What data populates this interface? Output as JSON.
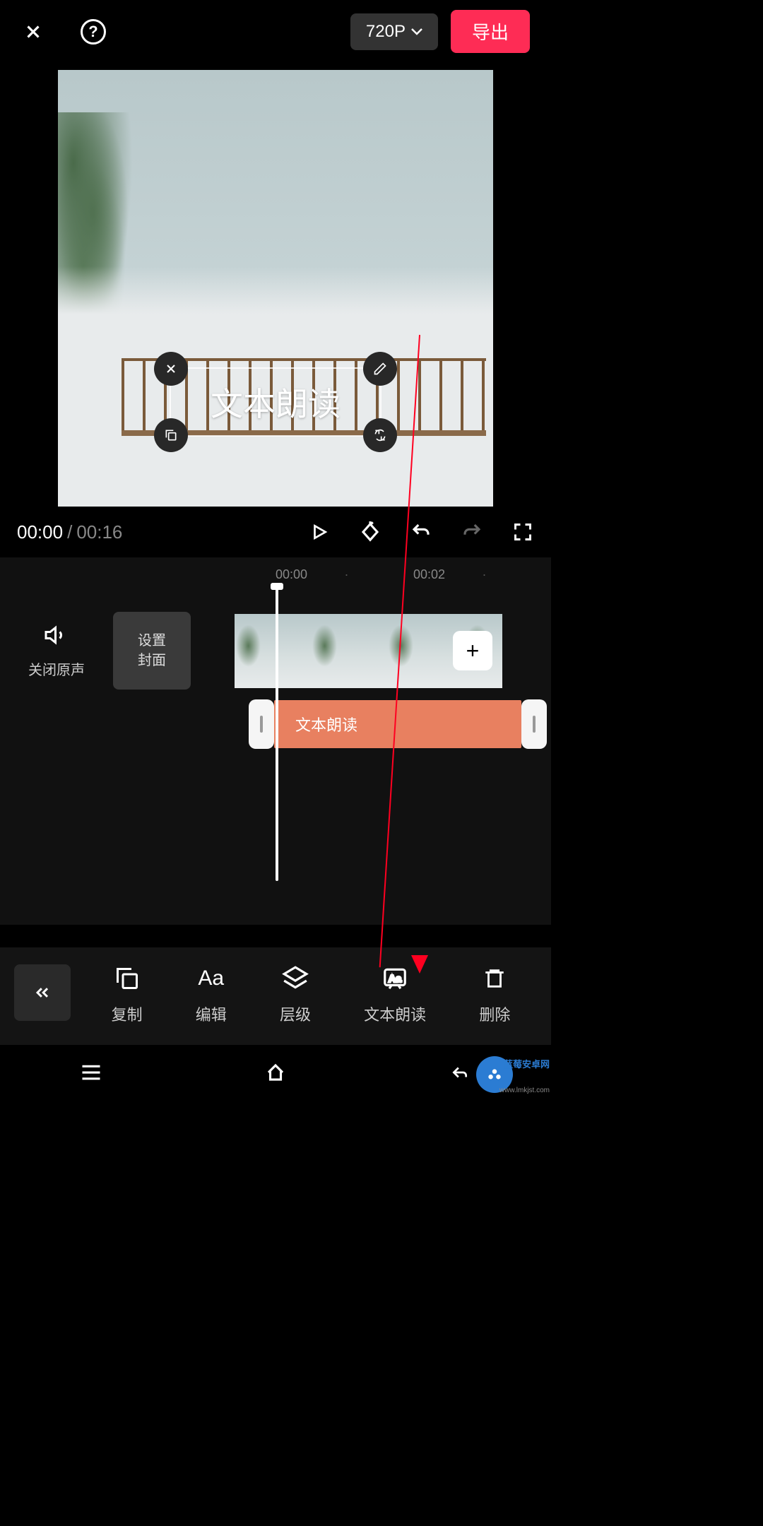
{
  "header": {
    "resolution": "720P",
    "export": "导出"
  },
  "preview": {
    "text_overlay": "文本朗读"
  },
  "playback": {
    "current": "00:00",
    "total": "00:16"
  },
  "timeline": {
    "marks": [
      "00:00",
      "·",
      "00:02",
      "·"
    ],
    "mute_label": "关闭原声",
    "cover_line1": "设置",
    "cover_line2": "封面",
    "text_clip": "文本朗读"
  },
  "toolbar": {
    "items": [
      {
        "icon": "copy",
        "label": "复制"
      },
      {
        "icon": "edit",
        "label": "编辑"
      },
      {
        "icon": "layers",
        "label": "层级"
      },
      {
        "icon": "tts",
        "label": "文本朗读"
      },
      {
        "icon": "delete",
        "label": "删除"
      }
    ]
  },
  "watermark": {
    "brand": "蓝莓安卓网",
    "url": "www.lmkjst.com"
  }
}
